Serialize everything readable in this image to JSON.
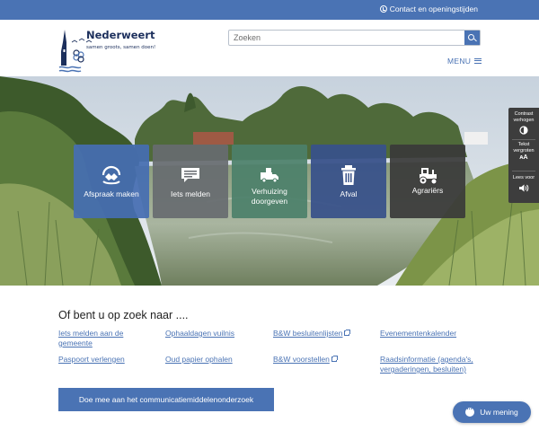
{
  "topbar": {
    "contact_label": "Contact en openingstijden",
    "contact_icon": "clock-icon"
  },
  "header": {
    "logo_name": "Nederweert",
    "logo_tagline": "samen groots, samen doen!",
    "search_placeholder": "Zoeken",
    "search_value": "",
    "menu_label": "MENU"
  },
  "tiles": [
    {
      "label": "Afspraak maken",
      "icon": "calendar-handshake-icon"
    },
    {
      "label": "Iets melden",
      "icon": "speech-bubble-icon"
    },
    {
      "label": "Verhuizing doorgeven",
      "icon": "moving-truck-icon"
    },
    {
      "label": "Afval",
      "icon": "trash-can-icon"
    },
    {
      "label": "Agrariërs",
      "icon": "tractor-icon"
    }
  ],
  "accessibility": {
    "contrast_label_1": "Contrast",
    "contrast_label_2": "verhogen",
    "text_label_1": "Tekst",
    "text_label_2": "vergroten",
    "read_label": "Lees voor"
  },
  "quick_links": {
    "title": "Of bent u op zoek naar ....",
    "items": [
      {
        "label_1": "Iets melden aan de",
        "label_2": "gemeente"
      },
      {
        "label_1": "Ophaaldagen vuilnis"
      },
      {
        "label_1": "B&W besluitenlijsten",
        "external": true
      },
      {
        "label_1": "Evenementenkalender"
      },
      {
        "label_1": "Paspoort verlengen"
      },
      {
        "label_1": "Oud papier ophalen"
      },
      {
        "label_1": "B&W voorstellen",
        "external": true
      },
      {
        "label_1": "Raadsinformatie (agenda's,",
        "label_2": "vergaderingen, besluiten)"
      }
    ]
  },
  "cta": {
    "label": "Doe mee aan het communicatiemiddelenonderzoek"
  },
  "feedback": {
    "label": "Uw mening"
  },
  "colors": {
    "brand_blue": "#4a73b4",
    "logo_navy": "#1c2f5c"
  }
}
